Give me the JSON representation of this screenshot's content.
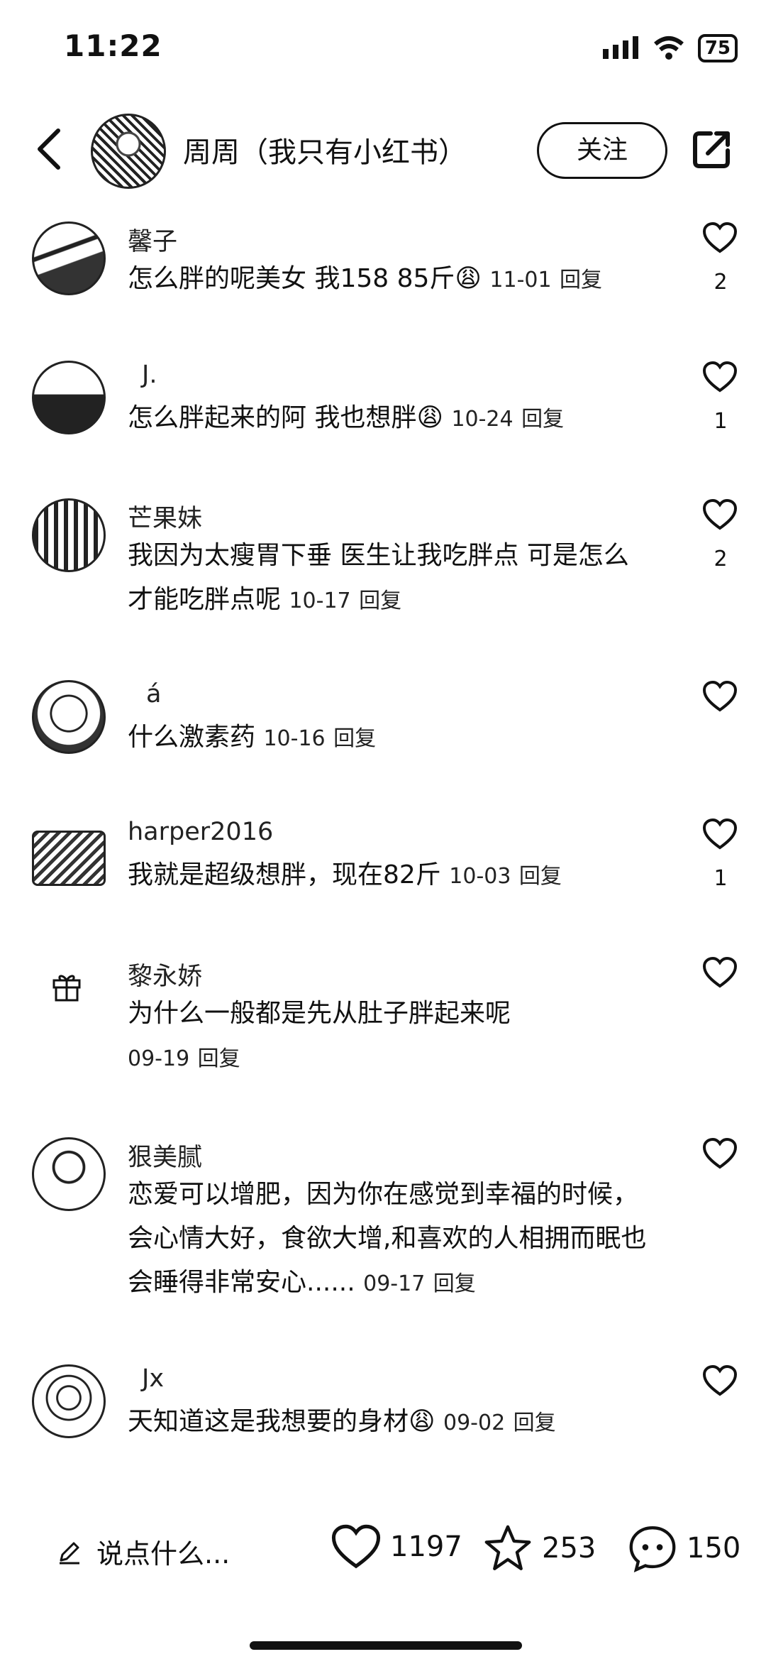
{
  "status": {
    "time": "11:22",
    "battery": "75"
  },
  "header": {
    "author_name": "周周（我只有小红书）",
    "follow_label": "关注",
    "icons": [
      "back-icon",
      "share-icon"
    ]
  },
  "comments": [
    {
      "name": "馨子",
      "text": "怎么胖的呢美女  我158  85斤",
      "emoji": "😩",
      "date": "11-01",
      "reply": "回复",
      "likes": "2"
    },
    {
      "name": "J.",
      "text": "怎么胖起来的阿 我也想胖",
      "emoji": "😩",
      "date": "10-24",
      "reply": "回复",
      "likes": "1"
    },
    {
      "name": "芒果妹",
      "text": "我因为太瘦胃下垂 医生让我吃胖点 可是怎么才能吃胖点呢",
      "emoji": "",
      "date": "10-17",
      "reply": "回复",
      "likes": "2"
    },
    {
      "name": "á",
      "text": "什么激素药",
      "emoji": "",
      "date": "10-16",
      "reply": "回复",
      "likes": ""
    },
    {
      "name": "harper2016",
      "text": "我就是超级想胖，现在82斤",
      "emoji": "",
      "date": "10-03",
      "reply": "回复",
      "likes": "1"
    },
    {
      "name": "黎永娇",
      "text": "为什么一般都是先从肚子胖起来呢",
      "emoji": "",
      "date": "09-19",
      "reply": "回复",
      "likes": ""
    },
    {
      "name": "狠美腻",
      "text": "恋爱可以增肥，因为你在感觉到幸福的时候，会心情大好，食欲大增,和喜欢的人相拥而眠也会睡得非常安心......",
      "emoji": "",
      "date": "09-17",
      "reply": "回复",
      "likes": ""
    },
    {
      "name": "Jx",
      "text": "天知道这是我想要的身材",
      "emoji": "😩",
      "date": "09-02",
      "reply": "回复",
      "likes": ""
    }
  ],
  "bottom": {
    "say_placeholder": "说点什么...",
    "likes": "1197",
    "stars": "253",
    "comments": "150"
  }
}
